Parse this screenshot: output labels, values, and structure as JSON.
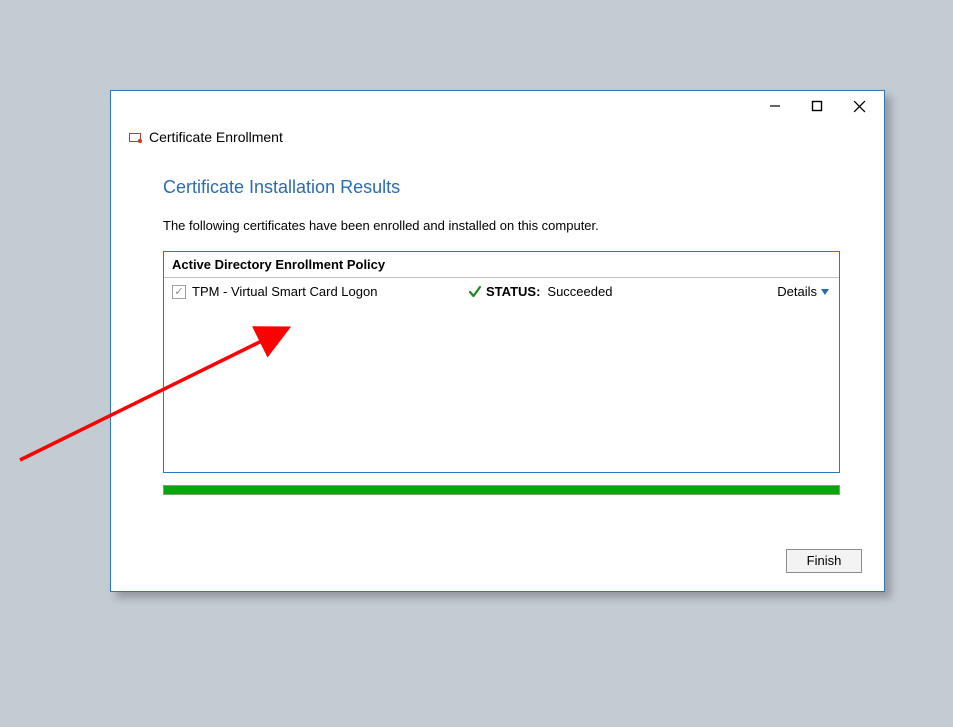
{
  "titlebar": {
    "title": "Certificate Enrollment"
  },
  "content": {
    "heading": "Certificate Installation Results",
    "subtext": "The following certificates have been enrolled and installed on this computer."
  },
  "policy": {
    "header": "Active Directory Enrollment Policy",
    "rows": [
      {
        "name": "TPM - Virtual Smart Card Logon",
        "status_label": "STATUS:",
        "status_value": "Succeeded",
        "details": "Details"
      }
    ]
  },
  "footer": {
    "finish": "Finish"
  },
  "colors": {
    "accent": "#2f77bc",
    "heading": "#2b6cb0",
    "progress_green": "#0aa50a"
  }
}
